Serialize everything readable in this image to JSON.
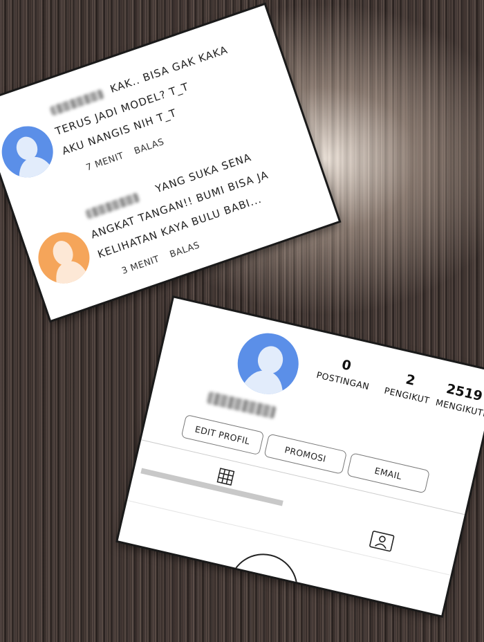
{
  "comments": [
    {
      "text_lines": [
        "KAK.. BISA GAK KAKA",
        "TERUS JADI MODEL? T_T",
        "AKU NANGIS NIH T_T"
      ],
      "time": "7 MENIT",
      "reply": "BALAS",
      "avatar_color": "#5b8fe8"
    },
    {
      "text_lines": [
        "YANG SUKA SENA",
        "ANGKAT TANGAN!! BUMI BISA JA",
        "KELIHATAN KAYA BULU BABI..."
      ],
      "time": "3 MENIT",
      "reply": "BALAS",
      "avatar_color": "#f5a55a"
    }
  ],
  "profile": {
    "avatar_color": "#5b8fe8",
    "stats": [
      {
        "value": "0",
        "label": "POSTINGAN"
      },
      {
        "value": "2",
        "label": "PENGIKUT"
      },
      {
        "value": "2519",
        "label": "MENGIKUTI"
      }
    ],
    "buttons": {
      "edit": "EDIT PROFIL",
      "promo": "PROMOSI",
      "email": "EMAIL"
    },
    "tabs": {
      "grid_icon": "grid-icon",
      "tagged_icon": "tagged-person-icon"
    },
    "empty_icon": "camera-icon"
  }
}
